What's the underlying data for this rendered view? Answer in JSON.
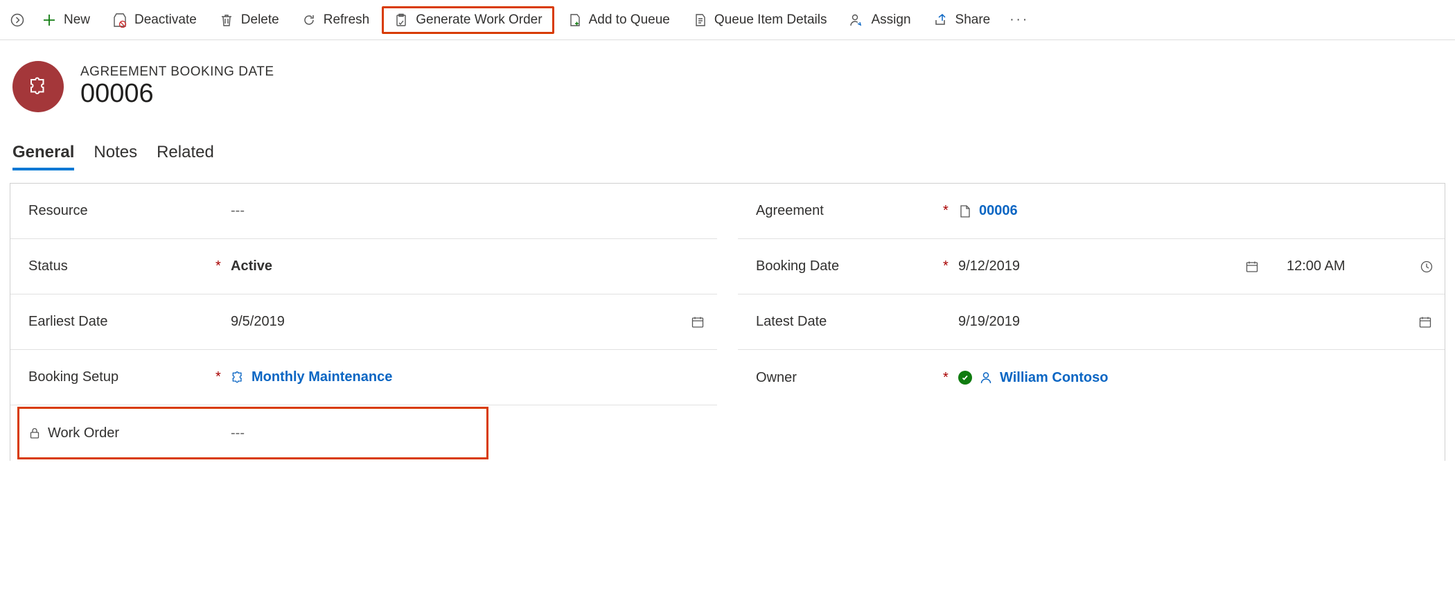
{
  "toolbar": {
    "new": "New",
    "deactivate": "Deactivate",
    "delete": "Delete",
    "refresh": "Refresh",
    "generate_wo": "Generate Work Order",
    "add_queue": "Add to Queue",
    "queue_details": "Queue Item Details",
    "assign": "Assign",
    "share": "Share"
  },
  "header": {
    "entity_type": "AGREEMENT BOOKING DATE",
    "record_name": "00006"
  },
  "tabs": {
    "general": "General",
    "notes": "Notes",
    "related": "Related"
  },
  "fields": {
    "resource": {
      "label": "Resource",
      "value": "---"
    },
    "status": {
      "label": "Status",
      "value": "Active"
    },
    "earliest": {
      "label": "Earliest Date",
      "value": "9/5/2019"
    },
    "booking_setup": {
      "label": "Booking Setup",
      "value": "Monthly Maintenance"
    },
    "work_order": {
      "label": "Work Order",
      "value": "---"
    },
    "agreement": {
      "label": "Agreement",
      "value": "00006"
    },
    "booking_date": {
      "label": "Booking Date",
      "date": "9/12/2019",
      "time": "12:00 AM"
    },
    "latest": {
      "label": "Latest Date",
      "value": "9/19/2019"
    },
    "owner": {
      "label": "Owner",
      "value": "William Contoso"
    }
  }
}
